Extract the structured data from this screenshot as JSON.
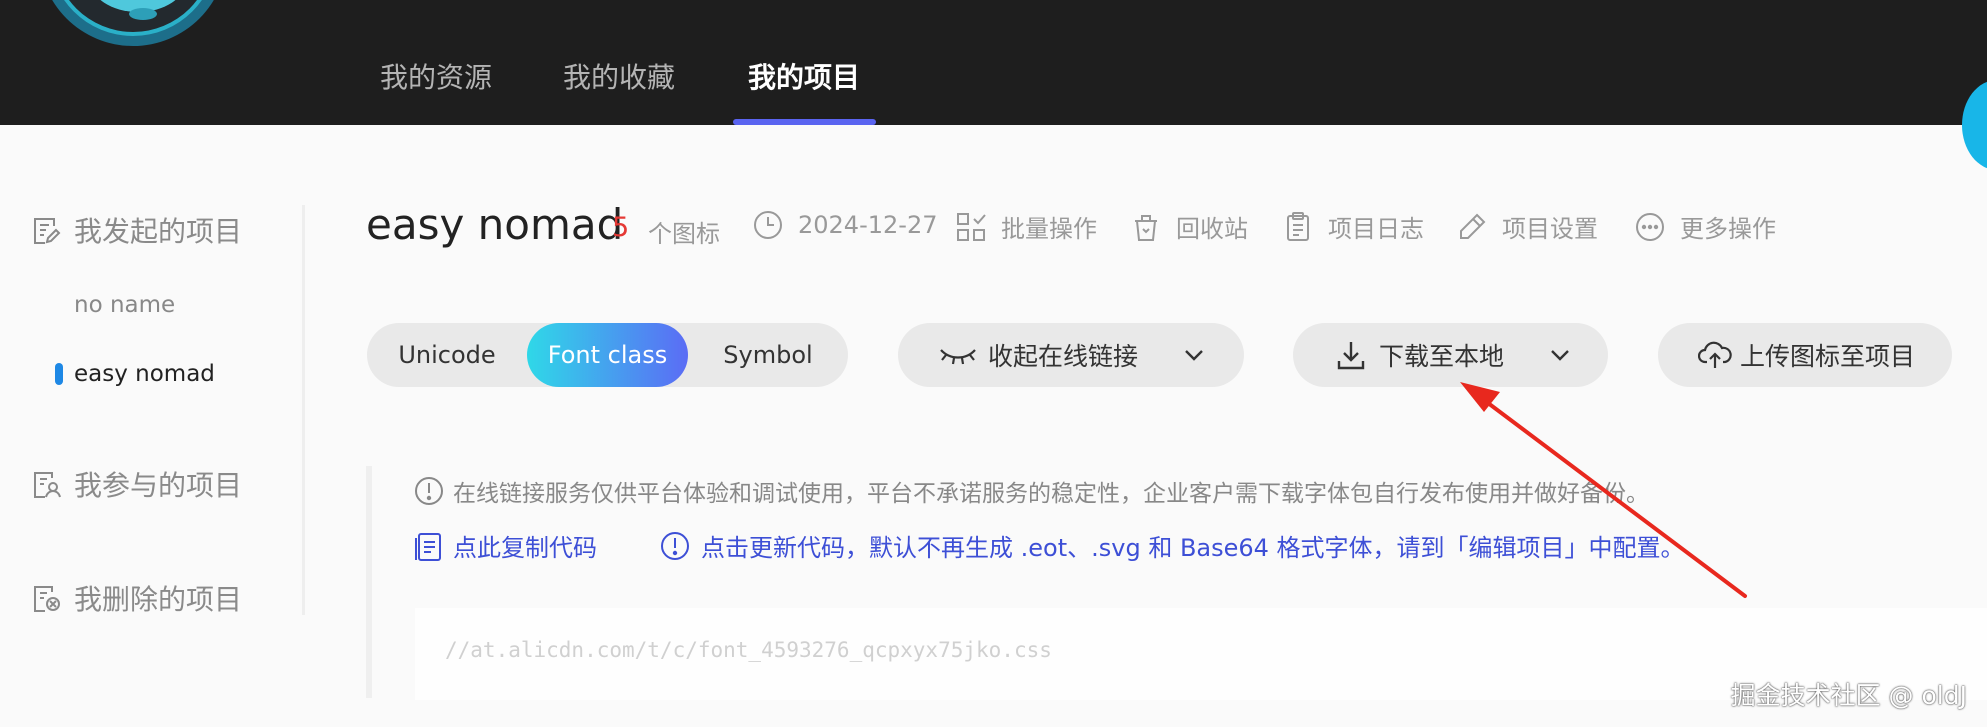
{
  "nav": {
    "tabs": [
      {
        "label": "我的资源"
      },
      {
        "label": "我的收藏"
      },
      {
        "label": "我的项目"
      }
    ]
  },
  "sidebar": {
    "initiated": {
      "label": "我发起的项目",
      "items": [
        {
          "label": "no name"
        },
        {
          "label": "easy nomad"
        }
      ]
    },
    "participated": {
      "label": "我参与的项目"
    },
    "deleted": {
      "label": "我删除的项目"
    }
  },
  "project": {
    "name": "easy nomad",
    "icon_count": "5",
    "icon_count_label": "个图标",
    "date": "2024-12-27",
    "actions": {
      "batch": "批量操作",
      "recycle": "回收站",
      "log": "项目日志",
      "settings": "项目设置",
      "more": "更多操作"
    }
  },
  "format_tabs": {
    "options": [
      {
        "label": "Unicode"
      },
      {
        "label": "Font class"
      },
      {
        "label": "Symbol"
      }
    ],
    "selected": "Font class"
  },
  "buttons": {
    "collapse_link": "收起在线链接",
    "download": "下载至本地",
    "upload": "上传图标至项目"
  },
  "notice": {
    "text": "在线链接服务仅供平台体验和调试使用，平台不承诺服务的稳定性，企业客户需下载字体包自行发布使用并做好备份。",
    "copy_code": "点此复制代码",
    "update_code": "点击更新代码，默认不再生成 .eot、.svg 和 Base64 格式字体，请到「编辑项目」中配置。"
  },
  "code": {
    "url": "//at.alicdn.com/t/c/font_4593276_qcpxyx75jko.css"
  },
  "watermark": "掘金技术社区 @ oldJ",
  "colors": {
    "header_bg": "#1e1e1e",
    "accent": "#5a64f0",
    "link": "#3d4fd6",
    "count": "#e53935",
    "active_marker": "#1e88e5",
    "annotation_arrow": "#e8281e"
  }
}
